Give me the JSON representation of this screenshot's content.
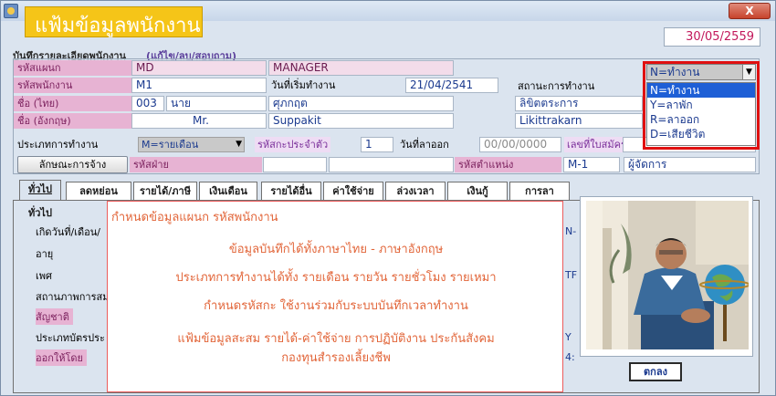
{
  "window": {
    "title": "แฟ้มข้อมูลพนักงาน",
    "close_label": "X",
    "date": "30/05/2559"
  },
  "record": {
    "group_title": "บันทึกรายละเอียดพนักงาน",
    "group_extra": "(แก้ไข/ลบ/สอบถาม)",
    "dept_label": "รหัสแผนก",
    "dept_code": "MD",
    "dept_name": "MANAGER",
    "emp_label": "รหัสพนักงาน",
    "emp_code": "M1",
    "start_label": "วันที่เริ่มทำงาน",
    "start_date": "21/04/2541",
    "status_label": "สถานะการทำงาน",
    "name_th_label": "ชื่อ (ไทย)",
    "prefix_code": "003",
    "prefix_th": "นาย",
    "first_th": "ศุภกฤต",
    "last_th": "ลิขิตตระการ",
    "name_en_label": "ชื่อ (อังกฤษ)",
    "prefix_en": "Mr.",
    "first_en": "Suppakit",
    "last_en": "Likittrakarn",
    "worktype_label": "ประเภทการทำงาน",
    "worktype_value": "M=รายเดือน",
    "card_label": "รหัสกะประจำตัว",
    "card_value": "1",
    "leave_label": "วันที่ลาออก",
    "leave_value": "00/00/0000",
    "apply_label": "เลขที่ใบสมัคร",
    "hire_btn": "ลักษณะการจ้าง",
    "division_label": "รหัสฝ่าย",
    "position_label": "รหัสตำแหน่ง",
    "position_code": "M-1",
    "position_name": "ผู้จัดการ"
  },
  "status_dropdown": {
    "selected": "N=ทำงาน",
    "options": [
      "N=ทำงาน",
      "Y=ลาพัก",
      "R=ลาออก",
      "D=เสียชีวิต"
    ]
  },
  "tabs": [
    "ทั่วไป",
    "ลดหย่อน",
    "รายได้/ภาษี",
    "เงินเดือน",
    "รายได้อื่น",
    "ค่าใช้จ่าย",
    "ล่วงเวลา",
    "เงินกู้",
    "การลา"
  ],
  "general": {
    "title": "ทั่วไป",
    "labels": [
      "เกิดวันที่/เดือน/",
      "อายุ",
      "เพศ",
      "สถานภาพการสม",
      "สัญชาติ",
      "ประเภทบัตรประ",
      "ออกให้โดย"
    ]
  },
  "glimpse": [
    "N-",
    "TF",
    "Y",
    "4:"
  ],
  "overlay": {
    "lines": [
      "กำหนดข้อมูลแผนก  รหัสพนักงาน",
      "ข้อมูลบันทึกได้ทั้งภาษาไทย - ภาษาอังกฤษ",
      "ประเภทการทำงานได้ทั้ง   รายเดือน รายวัน รายชั่วโมง รายเหมา",
      "กำหนดรหัสกะ   ใช้งานร่วมกับระบบบันทึกเวลาทำงาน",
      "แฟ้มข้อมูลสะสม   รายได้-ค่าใช้จ่าย การปฏิบัติงาน ประกันสังคม",
      "กองทุนสำรองเลี้ยงชีพ"
    ]
  },
  "ok_button": "ตกลง",
  "colors": {
    "accent": "#f5c518",
    "pink": "#e7b3d3",
    "highlight": "#e01010",
    "overlay_text": "#e2663a"
  },
  "icons": [
    "app-icon",
    "close-icon",
    "dropdown-arrow-icon",
    "employee-photo"
  ]
}
